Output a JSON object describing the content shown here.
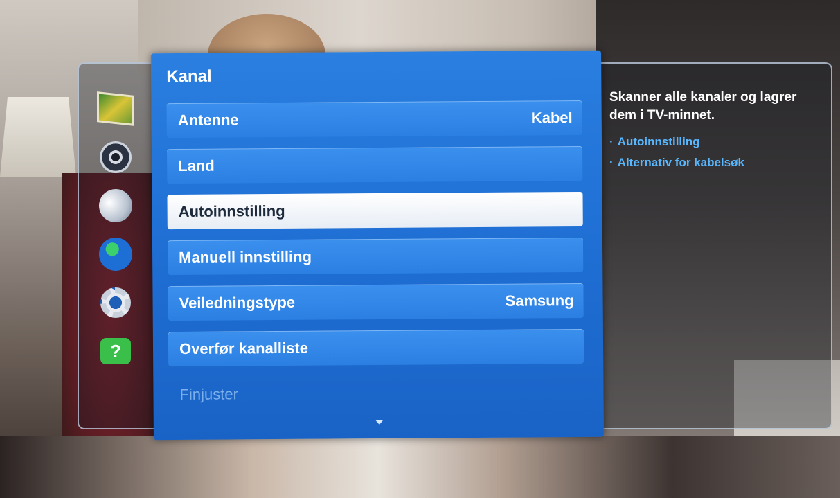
{
  "menu": {
    "title": "Kanal",
    "items": [
      {
        "label": "Antenne",
        "value": "Kabel"
      },
      {
        "label": "Land",
        "value": ""
      },
      {
        "label": "Autoinnstilling",
        "value": ""
      },
      {
        "label": "Manuell innstilling",
        "value": ""
      },
      {
        "label": "Veiledningstype",
        "value": "Samsung"
      },
      {
        "label": "Overfør kanalliste",
        "value": ""
      },
      {
        "label": "Finjuster",
        "value": ""
      }
    ]
  },
  "help": {
    "text": "Skanner alle kanaler og lagrer dem i TV-minnet.",
    "links": [
      "Autoinnstilling",
      "Alternativ for kabelsøk"
    ]
  },
  "side_icons": [
    "picture-icon",
    "sound-icon",
    "broadcast-icon",
    "network-icon",
    "system-icon",
    "support-icon"
  ],
  "support_icon_glyph": "?",
  "colors": {
    "panel_blue": "#1f6fd4",
    "item_blue": "#2b7fe2",
    "selected": "#ffffff",
    "help_link": "#59b7ff"
  }
}
